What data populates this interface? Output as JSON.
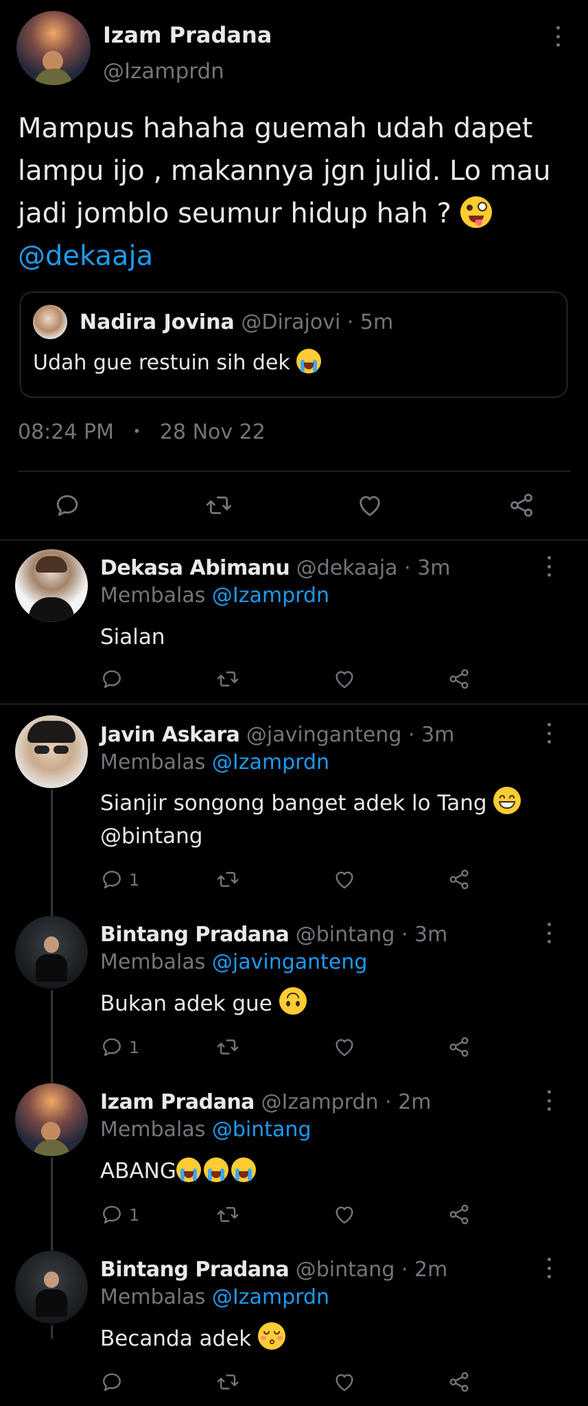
{
  "main_tweet": {
    "author_name": "Izam Pradana",
    "author_handle": "@Izamprdn",
    "text_line1": "Mampus hahaha guemah udah dapet",
    "text_line2": "lampu ijo , makannya jgn julid. Lo mau",
    "text_line3": "jadi jomblo seumur hidup hah ?",
    "mention": "@dekaaja",
    "quote": {
      "author_name": "Nadira Jovina",
      "author_handle": "@Dirajovi",
      "time": "· 5m",
      "text": "Udah gue restuin sih dek"
    },
    "time": "08:24 PM",
    "dot": "•",
    "date": "28 Nov 22"
  },
  "replies": [
    {
      "name": "Dekasa Abimanu",
      "handle": "@dekaaja",
      "time": "· 3m",
      "replying_label": "Membalas",
      "replying_to": "@Izamprdn",
      "text": "Sialan",
      "reply_count": ""
    },
    {
      "name": "Javin Askara",
      "handle": "@javinganteng",
      "time": "· 3m",
      "replying_label": "Membalas",
      "replying_to": "@Izamprdn",
      "text": "Sianjir songong banget adek lo Tang",
      "text2": "@bintang",
      "reply_count": "1"
    },
    {
      "name": "Bintang Pradana",
      "handle": "@bintang",
      "time": "· 3m",
      "replying_label": "Membalas",
      "replying_to": "@javinganteng",
      "text": "Bukan adek gue",
      "reply_count": "1"
    },
    {
      "name": "Izam Pradana",
      "handle": "@Izamprdn",
      "time": "· 2m",
      "replying_label": "Membalas",
      "replying_to": "@bintang",
      "text": "ABANG",
      "reply_count": "1"
    },
    {
      "name": "Bintang Pradana",
      "handle": "@bintang",
      "time": "· 2m",
      "replying_label": "Membalas",
      "replying_to": "@Izamprdn",
      "text": "Becanda adek",
      "reply_count": ""
    }
  ],
  "icons": {
    "reply": "reply-icon",
    "retweet": "retweet-icon",
    "like": "heart-icon",
    "share": "share-icon",
    "more": "more-vertical-icon"
  },
  "colors": {
    "background": "#000000",
    "text": "#e7e9ea",
    "muted": "#71767b",
    "link": "#1d9bf0"
  }
}
